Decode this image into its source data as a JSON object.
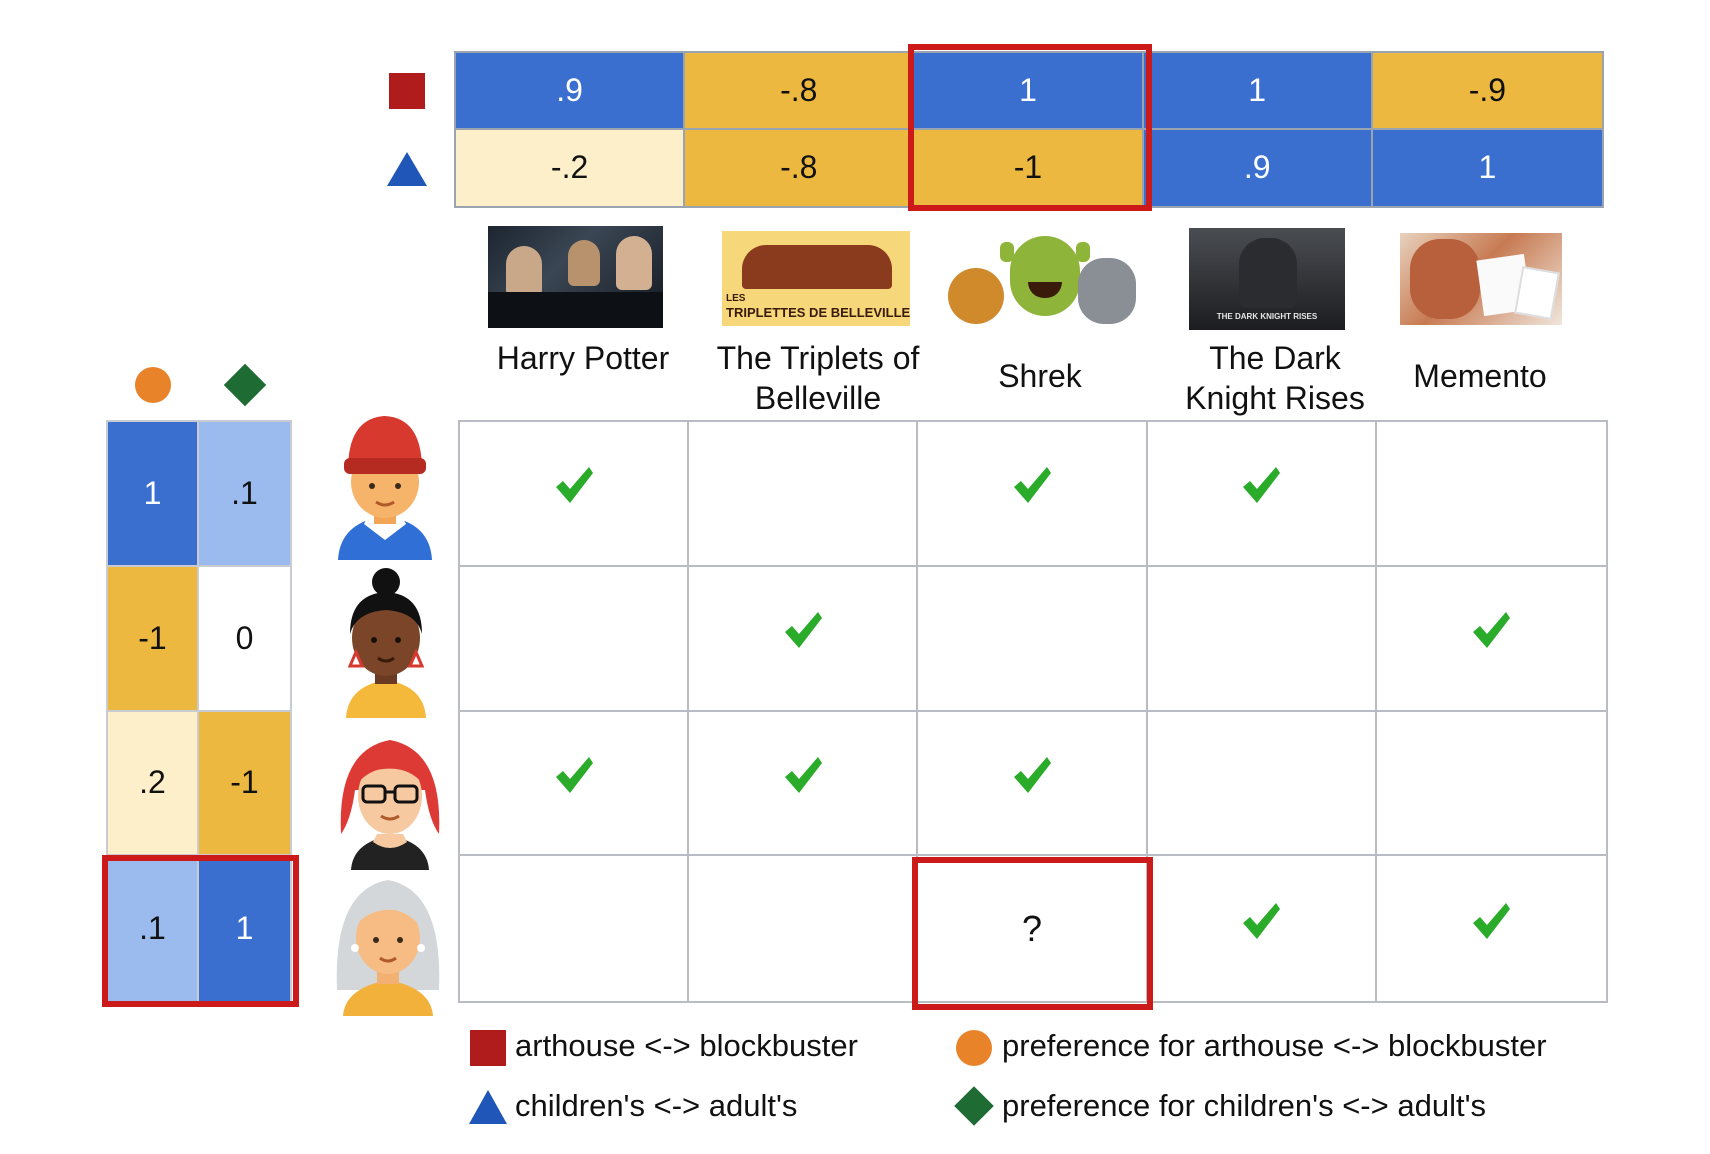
{
  "colors": {
    "dark_blue": "#3a6fd0",
    "light_blue": "#9bbbee",
    "gold": "#ecb840",
    "cream": "#fdefc9",
    "highlight_red": "#cc1a1a",
    "square_red": "#b01c1c",
    "triangle_blue": "#1f56b8",
    "circle_orange": "#e8832a",
    "diamond_green": "#1e6b34",
    "check_green": "#2aab2a"
  },
  "movie_factors": {
    "square_row": [
      ".9",
      "-.8",
      "1",
      "1",
      "-.9"
    ],
    "triangle_row": [
      "-.2",
      "-.8",
      "-1",
      ".9",
      "1"
    ]
  },
  "movies": [
    {
      "title_line1": "Harry Potter",
      "title_line2": ""
    },
    {
      "title_line1": "The Triplets of",
      "title_line2": "Belleville"
    },
    {
      "title_line1": "Shrek",
      "title_line2": ""
    },
    {
      "title_line1": "The Dark",
      "title_line2": "Knight Rises"
    },
    {
      "title_line1": "Memento",
      "title_line2": ""
    }
  ],
  "poster_text": {
    "triplets": "TRIPLETTES DE BELLEVILLE",
    "triplets_small": "LES",
    "dark_knight": "THE DARK KNIGHT RISES"
  },
  "user_factors": [
    {
      "circle": "1",
      "diamond": ".1"
    },
    {
      "circle": "-1",
      "diamond": "0"
    },
    {
      "circle": ".2",
      "diamond": "-1"
    },
    {
      "circle": ".1",
      "diamond": "1"
    }
  ],
  "ratings": [
    [
      true,
      false,
      true,
      true,
      false
    ],
    [
      false,
      true,
      false,
      false,
      true
    ],
    [
      true,
      true,
      true,
      false,
      false
    ],
    [
      false,
      false,
      "?",
      true,
      true
    ]
  ],
  "unknown_mark": "?",
  "legend": {
    "square": "arthouse <-> blockbuster",
    "triangle": "children's <-> adult's",
    "circle": "preference for arthouse <-> blockbuster",
    "diamond": "preference for children's <-> adult's"
  },
  "icons": {
    "square": "red-square-icon",
    "triangle": "blue-triangle-icon",
    "circle": "orange-circle-icon",
    "diamond": "green-diamond-icon",
    "check": "checkmark-icon"
  }
}
